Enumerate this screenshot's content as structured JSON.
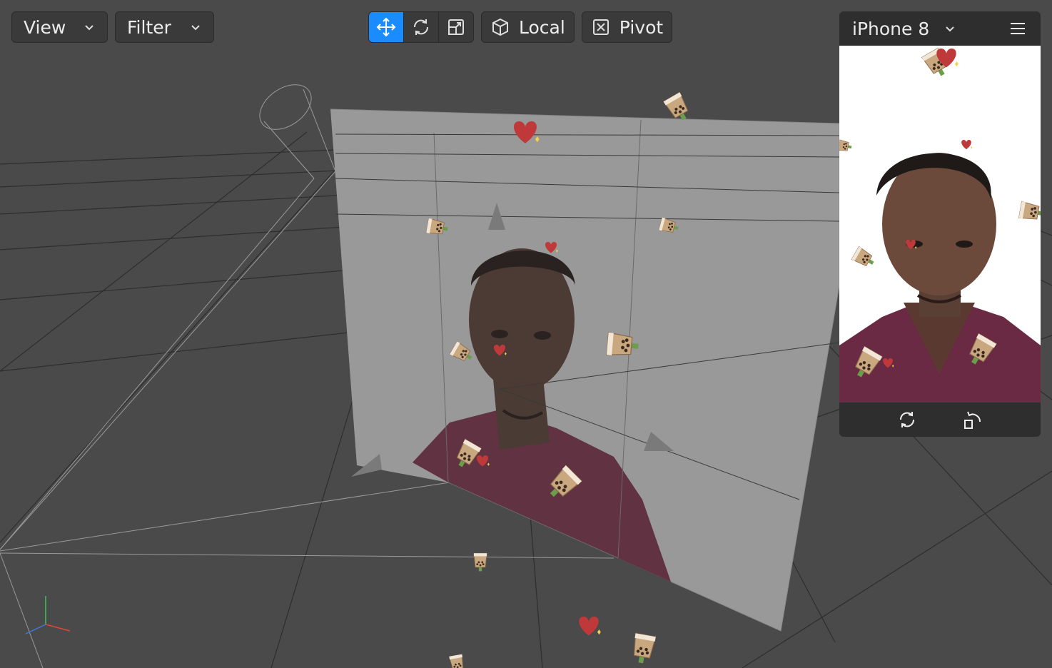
{
  "toolbar": {
    "view_label": "View",
    "filter_label": "Filter",
    "transform_tools": [
      {
        "name": "move",
        "icon": "move-icon",
        "active": true
      },
      {
        "name": "rotate",
        "icon": "rotate-icon",
        "active": false
      },
      {
        "name": "scale",
        "icon": "scale-icon",
        "active": false
      }
    ],
    "space_label": "Local",
    "space_icon": "cube-icon",
    "pivot_label": "Pivot",
    "pivot_icon": "pivot-icon"
  },
  "preview": {
    "device_label": "iPhone 8",
    "menu_icon": "hamburger-menu-icon",
    "footer_icons": [
      "flip-camera-icon",
      "rotate-device-icon"
    ]
  },
  "scene": {
    "objects": [
      "camera-wireframe",
      "face-plane",
      "world-grid",
      "bounding-box",
      "axis-gizmo",
      "boba-tea-sticker",
      "heart-sticker"
    ]
  },
  "colors": {
    "accent": "#1a8cff",
    "panel": "#3a3a3a",
    "viewport": "#4a4a4a",
    "shirt": "#6a2a44",
    "heart": "#c0393a"
  }
}
